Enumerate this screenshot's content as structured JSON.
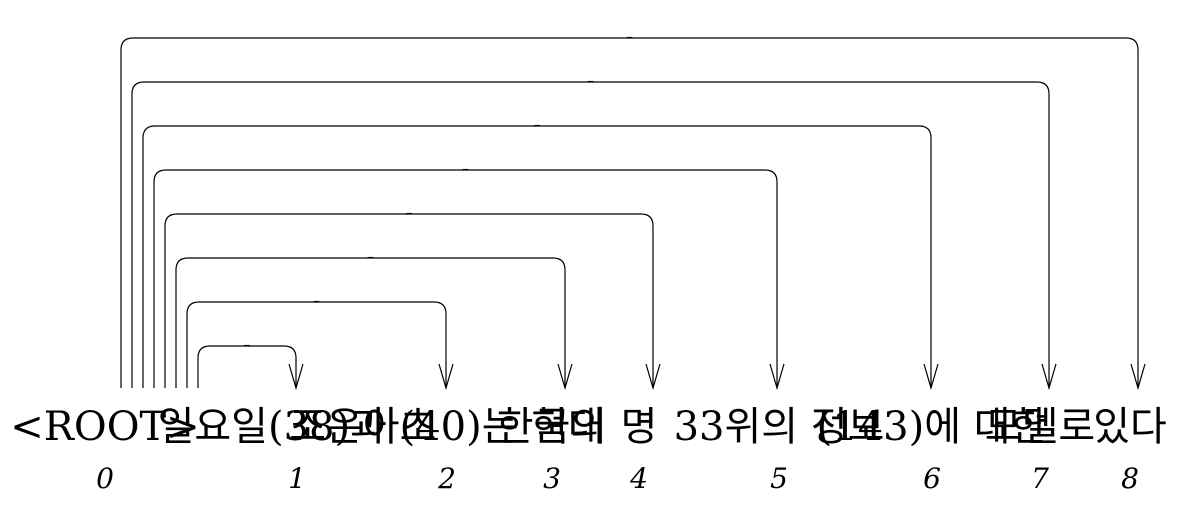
{
  "tokens": [
    {
      "index": "0",
      "text": "<ROOT>"
    },
    {
      "index": "1",
      "text": "일요일(38)과 초"
    },
    {
      "index": "2",
      "text": "조은아(40)는 현대"
    },
    {
      "index": "3",
      "text": "한국의"
    },
    {
      "index": "4",
      "text": "명"
    },
    {
      "index": "5",
      "text": "33위의 정보"
    },
    {
      "index": "6",
      "text": "(143)에 대한"
    },
    {
      "index": "7",
      "text": "모델로"
    },
    {
      "index": "8",
      "text": "있다"
    }
  ],
  "arcs": [
    {
      "from": 0,
      "to": 1,
      "label": "_"
    },
    {
      "from": 0,
      "to": 2,
      "label": "_"
    },
    {
      "from": 0,
      "to": 3,
      "label": "_"
    },
    {
      "from": 0,
      "to": 4,
      "label": "_"
    },
    {
      "from": 0,
      "to": 5,
      "label": "_"
    },
    {
      "from": 0,
      "to": 6,
      "label": "_"
    },
    {
      "from": 0,
      "to": 7,
      "label": "_"
    },
    {
      "from": 0,
      "to": 8,
      "label": "_"
    }
  ]
}
